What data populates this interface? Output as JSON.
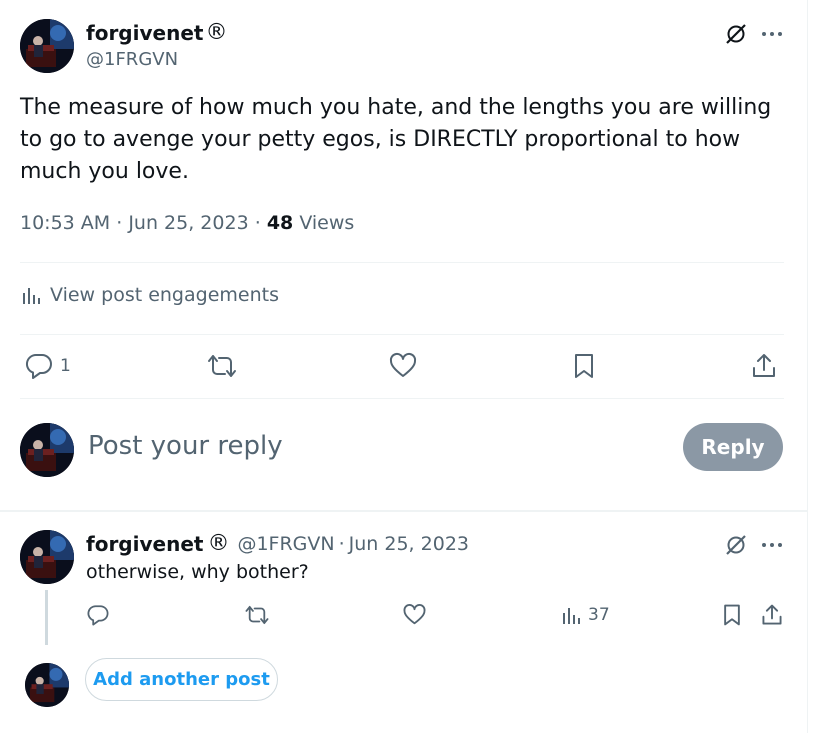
{
  "post": {
    "author_name": "forgivenet",
    "author_symbol": "®",
    "author_handle": "@1FRGVN",
    "text": "The measure of how much you hate, and the lengths you are willing to go to avenge your petty egos, is DIRECTLY proportional to how much you love.",
    "time": "10:53 AM",
    "date": "Jun 25, 2023",
    "views_count": "48",
    "views_label": "Views",
    "engagements_label": "View post engagements",
    "reply_count": "1"
  },
  "composer": {
    "placeholder": "Post your reply",
    "reply_button": "Reply"
  },
  "reply": {
    "author_name": "forgivenet",
    "author_symbol": "®",
    "author_handle": "@1FRGVN",
    "date": "Jun 25, 2023",
    "text": "otherwise, why bother?",
    "views_count": "37"
  },
  "thread": {
    "add_another_label": "Add another post"
  },
  "colors": {
    "text_primary": "#0f1419",
    "text_secondary": "#536471",
    "accent": "#1d9bf0",
    "reply_button_disabled": "#8b98a5",
    "divider": "#eff3f4"
  },
  "icons": [
    "avatar-image",
    "grok-icon",
    "more-icon",
    "analytics-icon",
    "reply-icon",
    "retweet-icon",
    "like-icon",
    "bookmark-icon",
    "share-icon"
  ]
}
